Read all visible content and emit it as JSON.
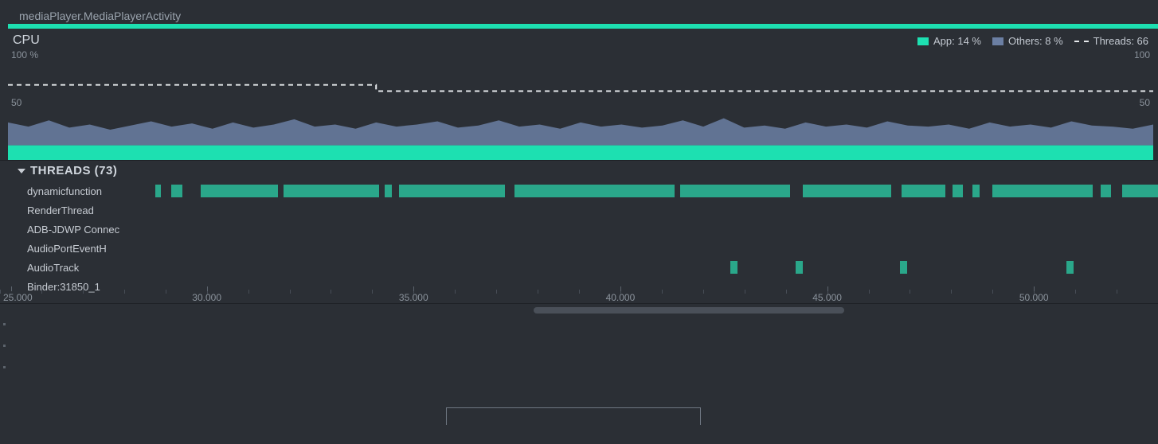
{
  "activity_title": "mediaPlayer.MediaPlayerActivity",
  "cpu": {
    "title": "CPU",
    "legend": {
      "app_label": "App: 14 %",
      "others_label": "Others: 8 %",
      "threads_label": "Threads: 66"
    },
    "y_left_top": "100 %",
    "y_left_mid": "50",
    "y_right_top": "100",
    "y_right_mid": "50",
    "colors": {
      "app": "#1de0b1",
      "others": "#6b7fa3",
      "threads_line": "#e6e9ec"
    }
  },
  "chart_data": {
    "type": "area",
    "xlabel": "",
    "ylabel": "%",
    "ylim": [
      0,
      100
    ],
    "x": [
      25,
      25.5,
      26,
      26.5,
      27,
      27.5,
      28,
      28.5,
      29,
      29.5,
      30,
      30.5,
      31,
      31.5,
      32,
      32.5,
      33,
      33.5,
      34,
      34.5,
      35,
      35.5,
      36,
      36.5,
      37,
      37.5,
      38,
      38.5,
      39,
      39.5,
      40,
      40.5,
      41,
      41.5,
      42,
      42.5,
      43,
      43.5,
      44,
      44.5,
      45,
      45.5,
      46,
      46.5,
      47,
      47.5,
      48,
      48.5,
      49,
      49.5,
      50,
      50.5,
      51,
      51.5,
      52,
      52.5,
      53
    ],
    "series": [
      {
        "name": "App",
        "values": [
          14,
          14,
          14,
          14,
          14,
          14,
          14,
          14,
          14,
          14,
          14,
          14,
          14,
          14,
          14,
          14,
          14,
          14,
          14,
          14,
          14,
          14,
          14,
          14,
          14,
          14,
          14,
          14,
          14,
          14,
          14,
          14,
          14,
          14,
          14,
          14,
          14,
          14,
          14,
          14,
          14,
          14,
          14,
          14,
          14,
          14,
          14,
          14,
          14,
          14,
          14,
          14,
          14,
          14,
          14,
          14,
          14
        ]
      },
      {
        "name": "Others",
        "values": [
          22,
          18,
          24,
          17,
          20,
          15,
          19,
          23,
          18,
          21,
          16,
          22,
          17,
          20,
          25,
          18,
          20,
          16,
          22,
          18,
          20,
          23,
          17,
          19,
          24,
          18,
          20,
          16,
          22,
          18,
          20,
          17,
          19,
          24,
          18,
          26,
          17,
          19,
          16,
          22,
          18,
          20,
          17,
          23,
          19,
          18,
          20,
          16,
          22,
          18,
          20,
          17,
          23,
          19,
          18,
          16,
          20
        ]
      }
    ],
    "threads_line": [
      {
        "x": 25,
        "y": 72
      },
      {
        "x": 34,
        "y": 72
      },
      {
        "x": 34,
        "y": 66
      },
      {
        "x": 53,
        "y": 66
      }
    ],
    "time_ticks": [
      "25.000",
      "30.000",
      "35.000",
      "40.000",
      "45.000",
      "50.000"
    ],
    "time_range": [
      25,
      53
    ]
  },
  "threads": {
    "header_label": "THREADS (73)",
    "rows": [
      {
        "name": "dynamicfunction",
        "segments": [
          [
            25.2,
            25.35
          ],
          [
            25.65,
            25.95
          ],
          [
            26.45,
            28.6
          ],
          [
            28.75,
            31.4
          ],
          [
            31.55,
            31.75
          ],
          [
            31.95,
            34.9
          ],
          [
            35.15,
            39.6
          ],
          [
            39.75,
            42.8
          ],
          [
            43.15,
            45.6
          ],
          [
            45.9,
            47.1
          ],
          [
            47.3,
            47.6
          ],
          [
            47.85,
            48.05
          ],
          [
            48.4,
            51.2
          ],
          [
            51.4,
            51.7
          ],
          [
            52.0,
            53.0
          ]
        ]
      },
      {
        "name": "RenderThread",
        "segments": []
      },
      {
        "name": "ADB-JDWP Connec",
        "segments": []
      },
      {
        "name": "AudioPortEventH",
        "segments": []
      },
      {
        "name": "AudioTrack",
        "segments": [
          [
            41.15,
            41.35
          ],
          [
            42.95,
            43.15
          ],
          [
            45.85,
            46.05
          ],
          [
            50.45,
            50.65
          ]
        ]
      },
      {
        "name": "Binder:31850_1",
        "segments": []
      }
    ]
  },
  "time_axis": {
    "labels": [
      {
        "value": "25.000",
        "t": 25
      },
      {
        "value": "30.000",
        "t": 30
      },
      {
        "value": "35.000",
        "t": 35
      },
      {
        "value": "40.000",
        "t": 40
      },
      {
        "value": "45.000",
        "t": 45
      },
      {
        "value": "50.000",
        "t": 50
      }
    ]
  }
}
